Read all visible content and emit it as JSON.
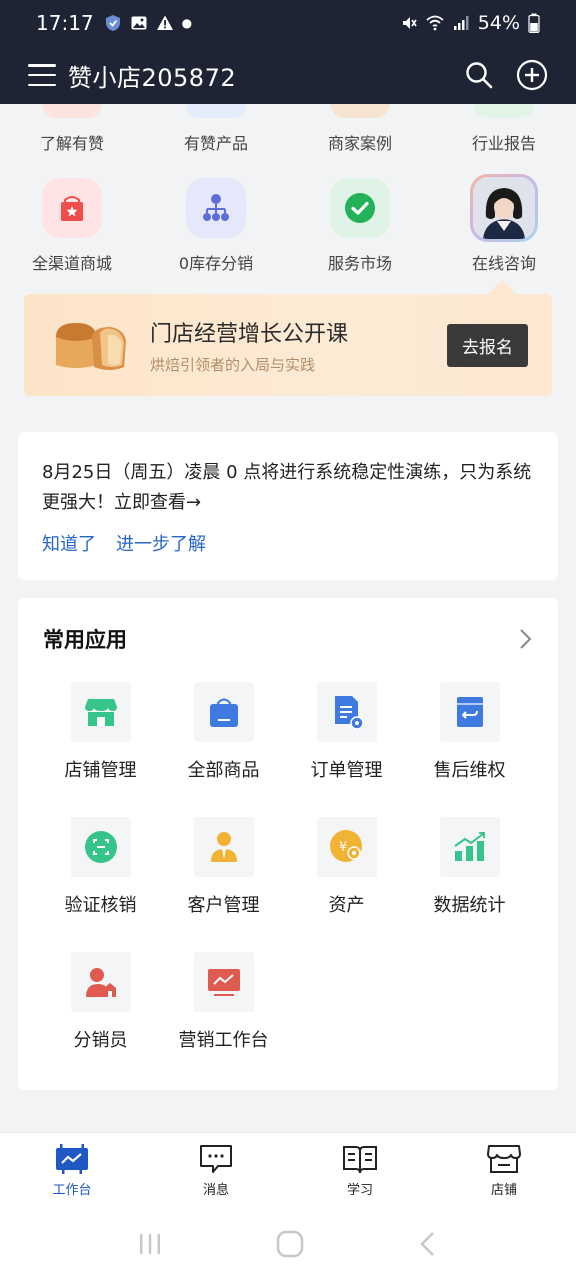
{
  "status_bar": {
    "time": "17:17",
    "battery": "54%"
  },
  "header": {
    "title": "赞小店205872"
  },
  "quick_links_top": [
    {
      "label": "了解有赞",
      "color": "#fbe3e0"
    },
    {
      "label": "有赞产品",
      "color": "#e4ebfb"
    },
    {
      "label": "商家案例",
      "color": "#f7e3d2"
    },
    {
      "label": "行业报告",
      "color": "#e2f4e6"
    }
  ],
  "quick_links": [
    {
      "label": "全渠道商城",
      "icon": "store-bag-icon"
    },
    {
      "label": "0库存分销",
      "icon": "distribution-tree-icon"
    },
    {
      "label": "服务市场",
      "icon": "check-circle-icon"
    },
    {
      "label": "在线咨询",
      "icon": "consultant-avatar"
    }
  ],
  "banner": {
    "title": "门店经营增长公开课",
    "subtitle": "烘焙引领者的入局与实践",
    "button": "去报名"
  },
  "notice": {
    "text": "8月25日（周五）凌晨 0 点将进行系统稳定性演练，只为系统更强大！立即查看→",
    "link_ok": "知道了",
    "link_more": "进一步了解"
  },
  "apps": {
    "title": "常用应用",
    "items": [
      {
        "label": "店铺管理",
        "icon": "shop-icon"
      },
      {
        "label": "全部商品",
        "icon": "shopping-bag-icon"
      },
      {
        "label": "订单管理",
        "icon": "order-doc-icon"
      },
      {
        "label": "售后维权",
        "icon": "after-sale-icon"
      },
      {
        "label": "验证核销",
        "icon": "scan-verify-icon"
      },
      {
        "label": "客户管理",
        "icon": "customer-icon"
      },
      {
        "label": "资产",
        "icon": "assets-coin-icon"
      },
      {
        "label": "数据统计",
        "icon": "data-chart-icon"
      },
      {
        "label": "分销员",
        "icon": "distributor-icon"
      },
      {
        "label": "营销工作台",
        "icon": "marketing-board-icon"
      }
    ]
  },
  "tabs": [
    {
      "label": "工作台",
      "icon": "workbench-icon",
      "active": true
    },
    {
      "label": "消息",
      "icon": "message-icon",
      "active": false
    },
    {
      "label": "学习",
      "icon": "book-icon",
      "active": false
    },
    {
      "label": "店铺",
      "icon": "storefront-icon",
      "active": false
    }
  ],
  "colors": {
    "header_bg": "#1f2435",
    "accent": "#1f57c3",
    "link": "#2666c5"
  }
}
